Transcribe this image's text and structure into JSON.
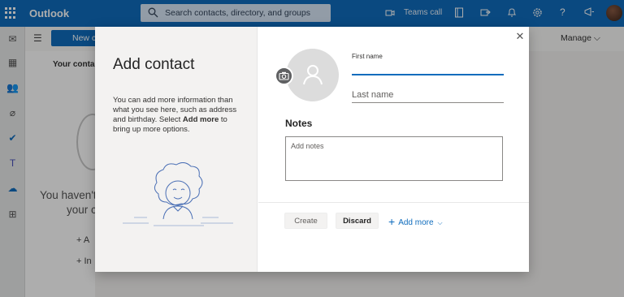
{
  "topbar": {
    "app_name": "Outlook",
    "search_placeholder": "Search contacts, directory, and groups",
    "teams_call": "Teams call"
  },
  "background": {
    "new_button": "New c",
    "manage": "Manage",
    "list_title": "Your contac",
    "empty_line1": "You haven't",
    "empty_line2": "your c",
    "action1": "+  A",
    "action2": "+  In"
  },
  "dialog": {
    "title": "Add contact",
    "description_pre": "You can add more information than what you see here, such as address and birthday. Select ",
    "description_bold": "Add more",
    "description_post": " to bring up more options.",
    "first_name_label": "First name",
    "first_name_value": "",
    "last_name_placeholder": "Last name",
    "notes_label": "Notes",
    "notes_placeholder": "Add notes",
    "create_button": "Create",
    "discard_button": "Discard",
    "add_more": "Add more"
  },
  "icons": {
    "waffle": "app-launcher-icon",
    "search": "search-icon",
    "camera": "camera-icon",
    "person": "person-icon",
    "close": "close-icon"
  },
  "colors": {
    "brand": "#0f6cbd",
    "dialog_left_bg": "#f3f2f1"
  }
}
